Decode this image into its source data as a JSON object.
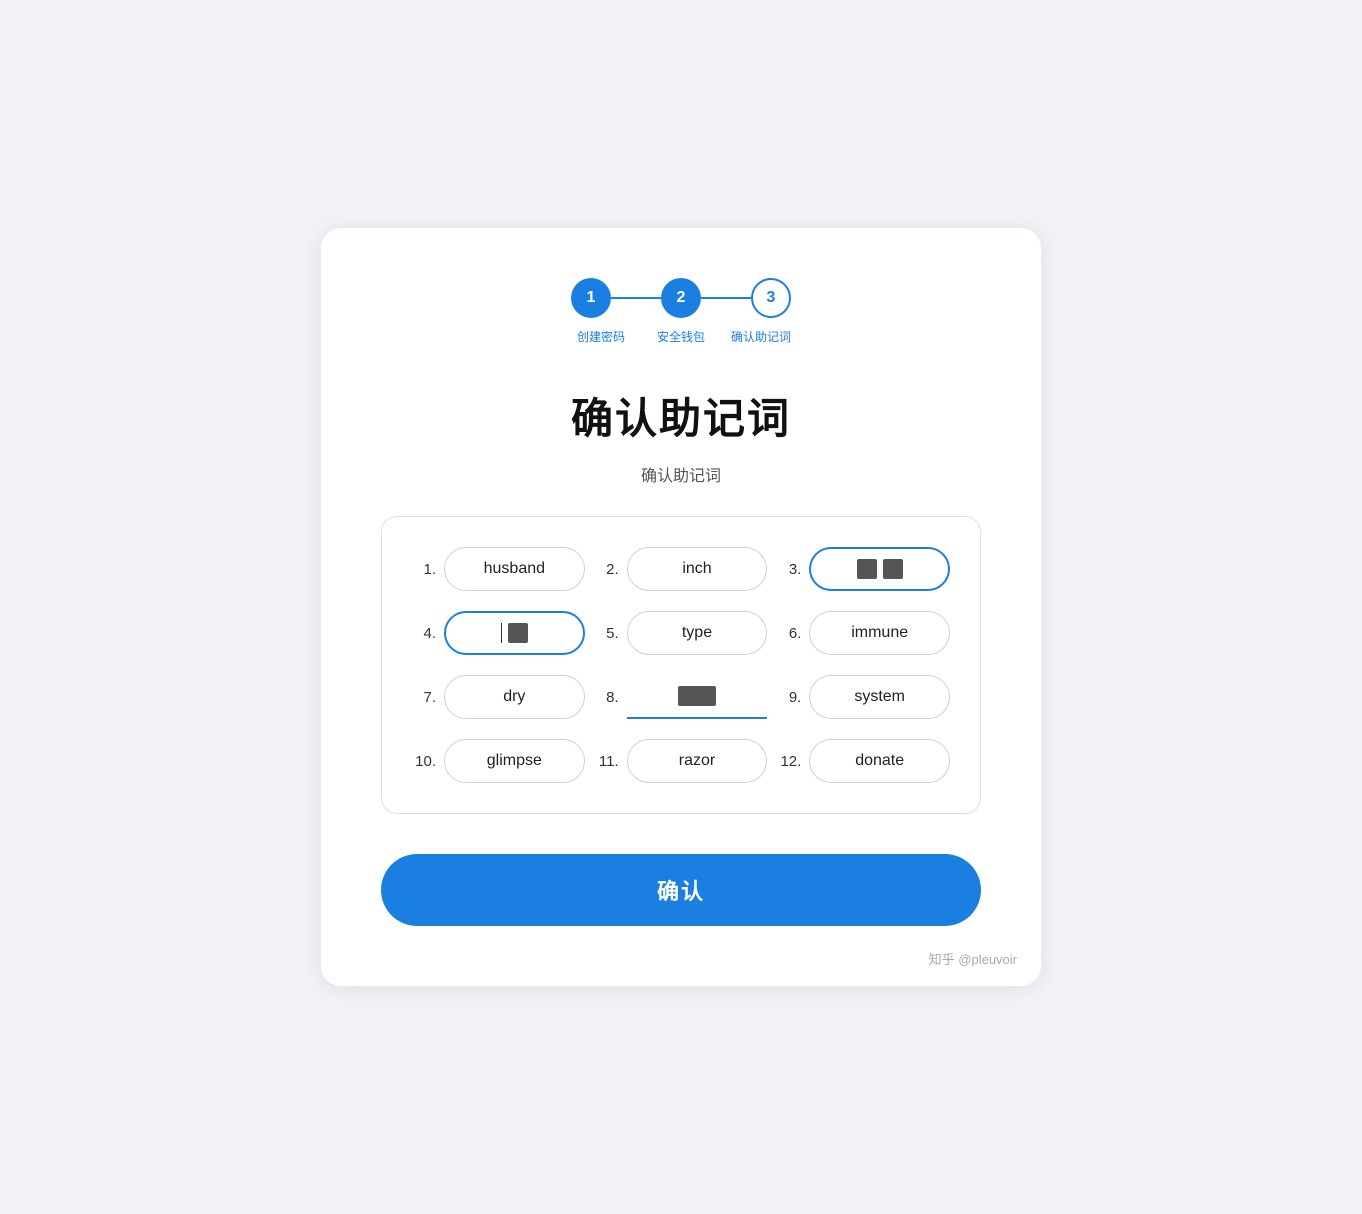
{
  "stepper": {
    "steps": [
      {
        "label": "1",
        "state": "active"
      },
      {
        "label": "2",
        "state": "active"
      },
      {
        "label": "3",
        "state": "inactive"
      }
    ],
    "labels": [
      "创建密码",
      "安全钱包",
      "确认助记词"
    ]
  },
  "page": {
    "main_title": "确认助记词",
    "sub_title": "确认助记词"
  },
  "words": [
    {
      "number": "1.",
      "text": "husband",
      "state": "normal"
    },
    {
      "number": "2.",
      "text": "inch",
      "state": "normal"
    },
    {
      "number": "3.",
      "text": "[redacted-2sq]",
      "state": "selected-blue"
    },
    {
      "number": "4.",
      "text": "[redacted-cursor]",
      "state": "selected-blue"
    },
    {
      "number": "5.",
      "text": "type",
      "state": "normal"
    },
    {
      "number": "6.",
      "text": "immune",
      "state": "normal"
    },
    {
      "number": "7.",
      "text": "dry",
      "state": "normal"
    },
    {
      "number": "8.",
      "text": "[redacted-wide]",
      "state": "typing"
    },
    {
      "number": "9.",
      "text": "system",
      "state": "normal"
    },
    {
      "number": "10.",
      "text": "glimpse",
      "state": "normal"
    },
    {
      "number": "11.",
      "text": "razor",
      "state": "normal"
    },
    {
      "number": "12.",
      "text": "donate",
      "state": "normal"
    }
  ],
  "confirm_button": {
    "label": "确认"
  },
  "watermark": {
    "text": "知乎 @pleuvoir"
  }
}
